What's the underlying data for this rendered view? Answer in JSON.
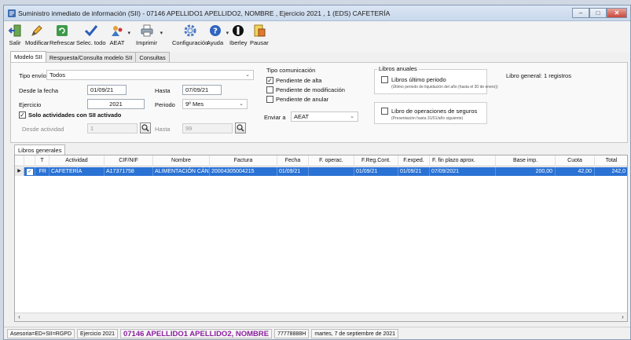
{
  "window": {
    "title": "Suministro inmediato de información (SII) - 07146 APELLIDO1 APELLIDO2, NOMBRE , Ejercicio 2021 , 1  (EDS) CAFETERÍA",
    "controls": {
      "minimize": "–",
      "maximize": "□",
      "close": "✕"
    }
  },
  "toolbar": {
    "salir": "Salir",
    "modificar": "Modificar",
    "refrescar": "Refrescar",
    "selec_todo": "Selec. todo",
    "aeat": "AEAT",
    "imprimir": "Imprimir",
    "configuracion": "Configuración",
    "ayuda": "Ayuda",
    "iberley": "Iberley",
    "pausar": "Pausar",
    "dropdown_glyph": "▾"
  },
  "tabs": [
    "Modelo SII",
    "Respuesta/Consulta modelo SII",
    "Consultas"
  ],
  "form": {
    "tipo_envio_label": "Tipo envío",
    "tipo_envio_value": "Todos",
    "desde_fecha_label": "Desde la fecha",
    "desde_fecha_value": "01/09/21",
    "hasta_label": "Hasta",
    "hasta_value": "07/09/21",
    "ejercicio_label": "Ejercicio",
    "ejercicio_value": "2021",
    "periodo_label": "Periodo",
    "periodo_value": "9º Mes",
    "solo_actividades_label": "Solo actividades con SII activado",
    "solo_actividades_checked": true,
    "desde_actividad_label": "Desde actividad",
    "desde_actividad_value": "1",
    "hasta_actividad_label": "Hasta",
    "hasta_actividad_value": "99",
    "tipo_comunicacion_title": "Tipo comunicación",
    "pendiente_alta_label": "Pendiente de alta",
    "pendiente_alta_checked": true,
    "pendiente_modificacion_label": "Pendiente de modificación",
    "pendiente_modificacion_checked": false,
    "pendiente_anular_label": "Pendiente de anular",
    "pendiente_anular_checked": false,
    "enviar_a_label": "Enviar a",
    "enviar_a_value": "AEAT",
    "libros_anuales_title": "Libros anuales",
    "libros_ultimo_periodo_label": "Libros último periodo",
    "libros_ultimo_periodo_note": "(Último periodo de liquidación del año (hasta el 30 de enero))",
    "libro_seguros_label": "Libro de operaciones de seguros",
    "libro_seguros_note": "(Presentación hasta 31/01/año siguiente)",
    "libro_general_info": "Libro general: 1 registros"
  },
  "grid": {
    "tab_label": "Libros generales",
    "columns": [
      "T",
      "Actividad",
      "CIF/NIF",
      "Nombre",
      "Factura",
      "Fecha",
      "F. operac.",
      "F.Reg.Cont.",
      "F.exped.",
      "F. fin plazo aprox.",
      "Base imp.",
      "Cuota",
      "Total"
    ],
    "rows": [
      {
        "selected": true,
        "checked": true,
        "t": "FR",
        "actividad": "CAFETERÍA",
        "cif": "A17371758",
        "nombre": "ALIMENTACIÓN CÁN...",
        "factura": "20004305004215",
        "fecha": "01/09/21",
        "f_operac": "",
        "f_reg_cont": "01/09/21",
        "f_exped": "01/09/21",
        "f_fin_plazo": "07/09/2021",
        "base_imp": "200,00",
        "cuota": "42,00",
        "total": "242,0"
      }
    ]
  },
  "statusbar": {
    "asesoria": "Asesoria=ED+SII=RGPD",
    "ejercicio": "Ejercicio 2021",
    "cliente": "07146 APELLIDO1 APELLIDO2, NOMBRE",
    "nif": "77778888H",
    "fecha": "martes, 7 de septiembre de 2021"
  },
  "colors": {
    "selection": "#2a72d4",
    "status_client": "#8a1f9e",
    "titlebar": "#c9d8ec"
  }
}
